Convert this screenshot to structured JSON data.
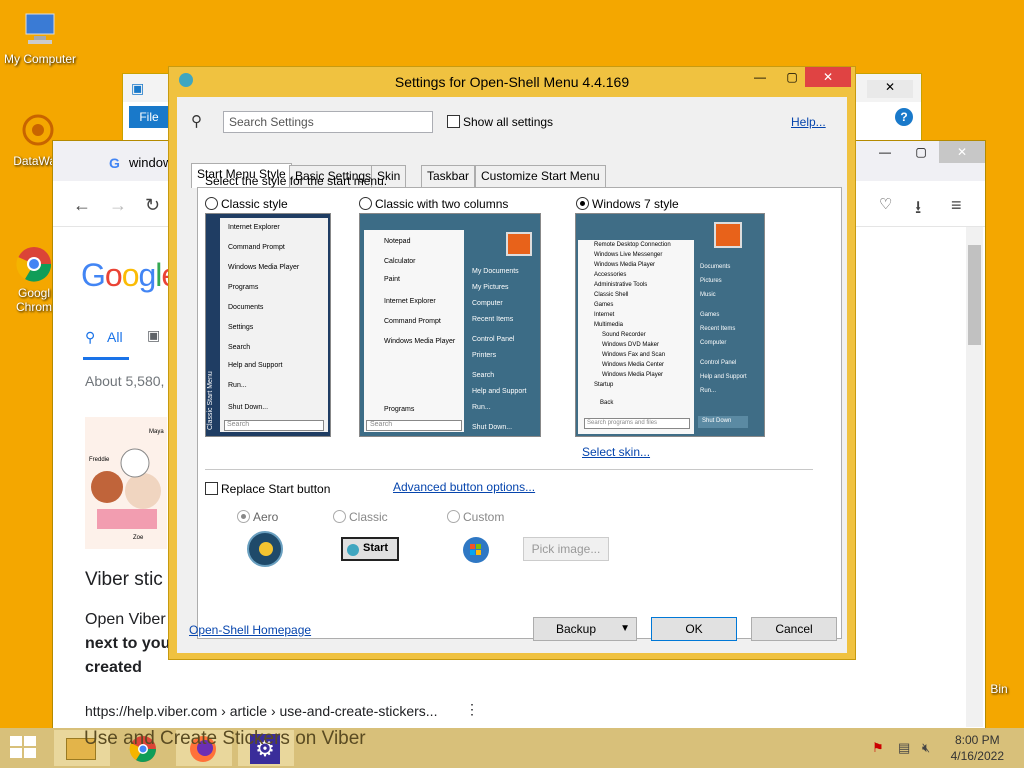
{
  "desktop": {
    "icons": [
      {
        "label": "My Computer"
      },
      {
        "label": "DataWag"
      },
      {
        "label": "Googl\nChrom"
      },
      {
        "label": "Bin"
      }
    ]
  },
  "browser": {
    "tab_title": "window",
    "tab_favicon": "G",
    "results_count": "About 5,580,",
    "tabs": {
      "all": "All"
    },
    "result_title": "Viber stic",
    "snippet_line1": "Open Viber",
    "snippet_line2": "next to you",
    "snippet_line3": "created",
    "result_url": "https://help.viber.com › article › use-and-create-stickers...",
    "result_next_title": "Use and Create Stickers on Viber",
    "image_captions": {
      "left": "Freddie",
      "right": "Zoe",
      "top": "Maya"
    }
  },
  "dialog": {
    "title": "Settings for Open-Shell Menu 4.4.169",
    "search_placeholder": "Search Settings",
    "show_all_label": "Show all settings",
    "help_link": "Help...",
    "tabs": [
      "Start Menu Style",
      "Basic Settings",
      "Skin",
      "Taskbar",
      "Customize Start Menu"
    ],
    "select_style_label": "Select the style for the start menu.",
    "styles": [
      {
        "label": "Classic style",
        "selected": false
      },
      {
        "label": "Classic with two columns",
        "selected": false
      },
      {
        "label": "Windows 7 style",
        "selected": true
      }
    ],
    "select_skin_link": "Select skin...",
    "replace_start_label": "Replace Start button",
    "advanced_button_link": "Advanced button options...",
    "button_styles": [
      {
        "label": "Aero",
        "selected": true
      },
      {
        "label": "Classic",
        "selected": false
      },
      {
        "label": "Custom",
        "selected": false
      }
    ],
    "classic_button_text": "Start",
    "pick_image_label": "Pick image...",
    "homepage_link": "Open-Shell Homepage",
    "backup_label": "Backup",
    "ok_label": "OK",
    "cancel_label": "Cancel",
    "previews": {
      "classic": {
        "items": [
          "Internet Explorer",
          "Command Prompt",
          "Windows Media Player",
          "Programs",
          "Documents",
          "Settings",
          "Search",
          "Help and Support",
          "Run...",
          "Shut Down..."
        ],
        "search": "Search",
        "side_label": "Classic Start Menu"
      },
      "two_columns": {
        "left_items": [
          "Notepad",
          "Calculator",
          "Paint",
          "Internet Explorer",
          "Command Prompt",
          "Windows Media Player"
        ],
        "programs": "Programs",
        "search": "Search",
        "right_items": [
          "My Documents",
          "My Pictures",
          "Computer",
          "Recent Items",
          "Control Panel",
          "Printers",
          "Search",
          "Help and Support",
          "Run...",
          "Shut Down..."
        ]
      },
      "win7": {
        "left_items": [
          "Remote Desktop Connection",
          "Windows Live Messenger",
          "Windows Media Player",
          "Accessories",
          "Administrative Tools",
          "Classic Shell",
          "Games",
          "Internet",
          "Multimedia",
          "Sound Recorder",
          "Windows DVD Maker",
          "Windows Fax and Scan",
          "Windows Media Center",
          "Windows Media Player",
          "Startup"
        ],
        "back": "Back",
        "search": "Search programs and files",
        "right_items": [
          "Documents",
          "Pictures",
          "Music",
          "Games",
          "Recent Items",
          "Computer",
          "Control Panel",
          "Help and Support",
          "Run..."
        ],
        "shutdown": "Shut Down"
      }
    }
  },
  "taskbar": {
    "time": "8:00 PM",
    "date": "4/16/2022"
  },
  "colors": {
    "desktop": "#f4a700",
    "dialog_frame": "#f0c240",
    "close_button": "#e04343",
    "link": "#0645ad"
  }
}
